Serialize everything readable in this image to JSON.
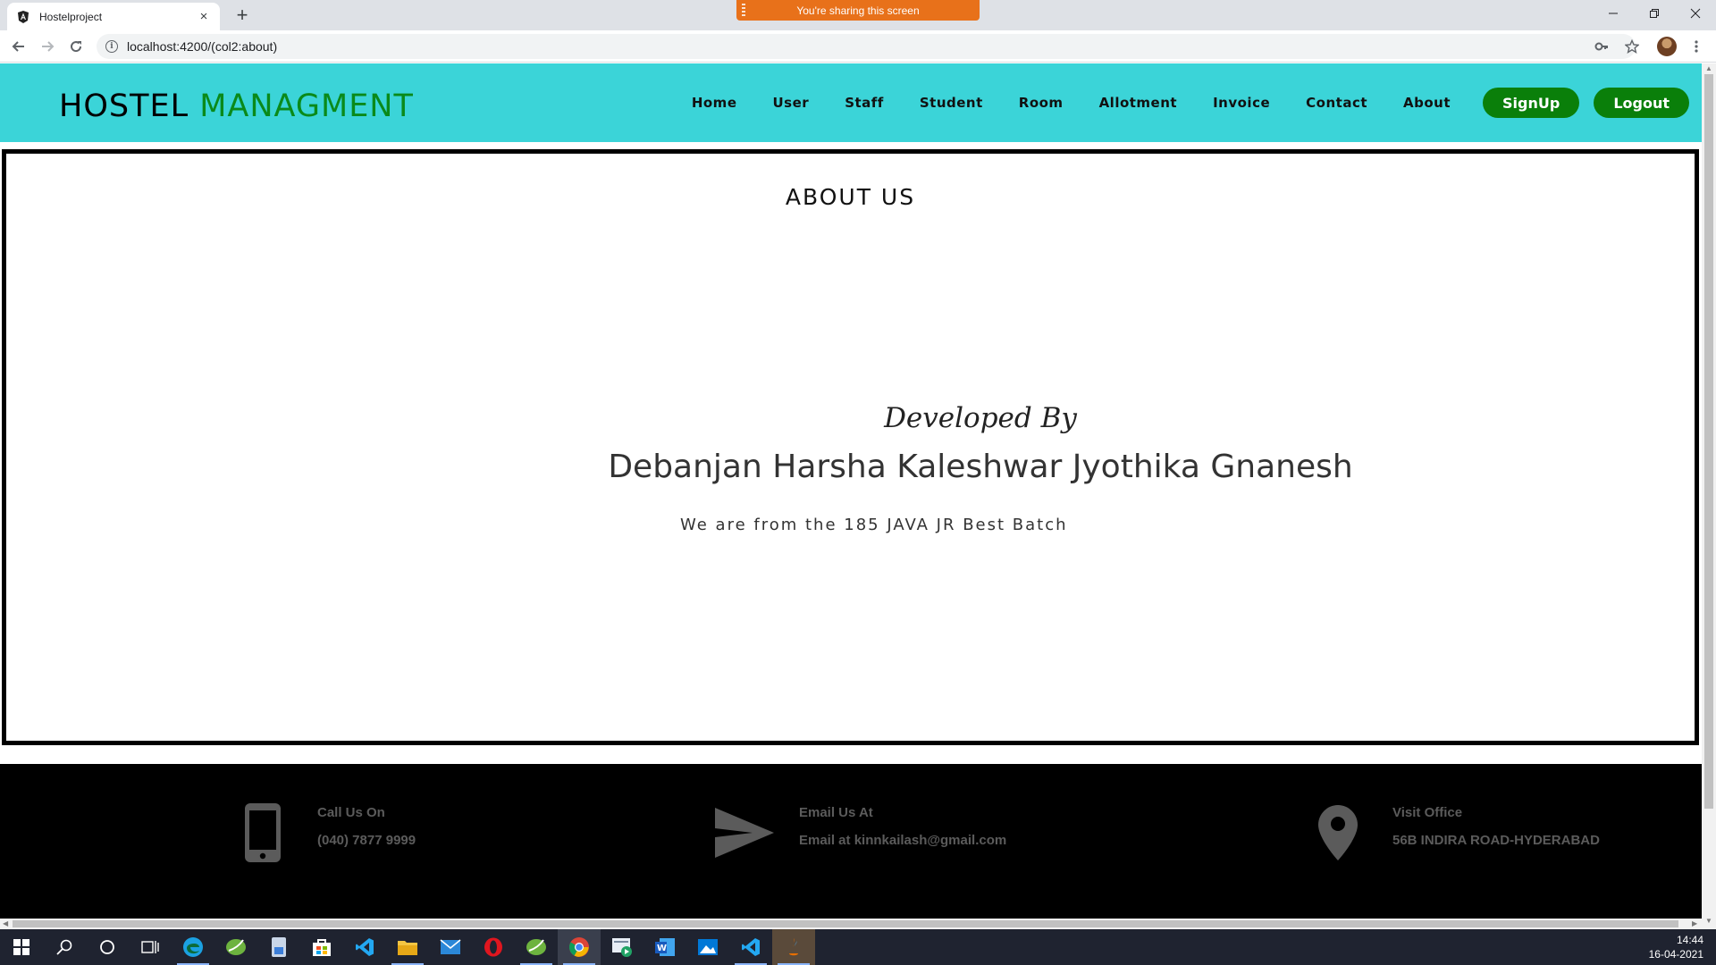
{
  "browser": {
    "tab_title": "Hostelproject",
    "tab_close": "×",
    "new_tab": "+",
    "sharing_banner": "You're sharing this screen",
    "url": "localhost:4200/(col2:about)",
    "info_glyph": "i"
  },
  "header": {
    "logo_part1": "HOSTEL",
    "logo_part2": "MANAGMENT",
    "nav": {
      "home": "Home",
      "user": "User",
      "staff": "Staff",
      "student": "Student",
      "room": "Room",
      "allotment": "Allotment",
      "invoice": "Invoice",
      "contact": "Contact",
      "about": "About"
    },
    "signup_label": "SignUp",
    "logout_label": "Logout"
  },
  "main": {
    "title": "ABOUT US",
    "developed_by": "Developed By",
    "developers": "Debanjan Harsha Kaleshwar Jyothika Gnanesh",
    "batch_text": "We are from the 185 JAVA JR Best Batch"
  },
  "footer": {
    "call": {
      "label": "Call Us On",
      "value": "(040) 7877 9999",
      "icon": "phone-icon"
    },
    "email": {
      "label": "Email Us At",
      "value": "Email at kinnkailash@gmail.com",
      "icon": "send-icon"
    },
    "visit": {
      "label": "Visit Office",
      "value": "56B INDIRA ROAD-HYDERABAD",
      "icon": "map-pin-icon"
    }
  },
  "taskbar": {
    "time": "14:44",
    "date": "16-04-2021"
  },
  "colors": {
    "header_bg": "#3bd4d8",
    "brand_green": "#0a8a1a",
    "button_green": "#0a7f0a",
    "footer_bg": "#000000",
    "footer_text": "#5b5b5b",
    "share_banner": "#e8711a"
  }
}
